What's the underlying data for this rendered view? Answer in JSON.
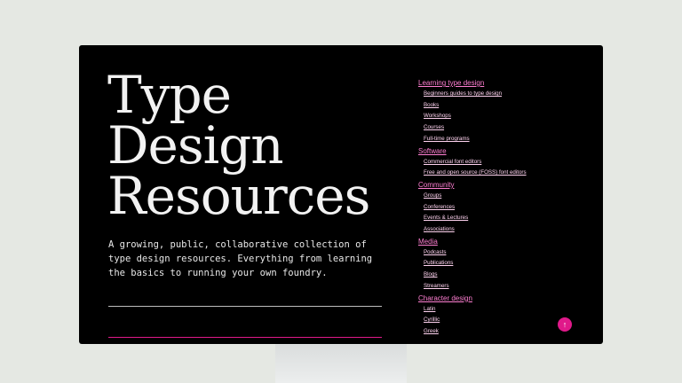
{
  "title_lines": [
    "Type",
    "Design",
    "Resources"
  ],
  "description": "A growing, public, collaborative collection of type design resources. Everything from learning the basics to running your own foundry.",
  "nav": [
    {
      "title": "Learning type design",
      "items": [
        "Beginners guides to type design",
        "Books",
        "Workshops",
        "Courses",
        "Full-time programs"
      ]
    },
    {
      "title": "Software",
      "items": [
        "Commercial font editors",
        "Free and open source (FOSS) font editors"
      ]
    },
    {
      "title": "Community",
      "items": [
        "Groups",
        "Conferences",
        "Events & Lectures",
        "Associations"
      ]
    },
    {
      "title": "Media",
      "items": [
        "Podcasts",
        "Publications",
        "Blogs",
        "Streamers"
      ]
    },
    {
      "title": "Character design",
      "items": [
        "Latin",
        "Cyrillic",
        "Greek"
      ]
    }
  ],
  "back_to_top": {
    "icon": "arrow-up-icon",
    "glyph": "↑"
  },
  "colors": {
    "accent": "#e0198a",
    "nav_title": "#ff7fd2",
    "background": "#000000",
    "wall": "#e5e8e3"
  }
}
